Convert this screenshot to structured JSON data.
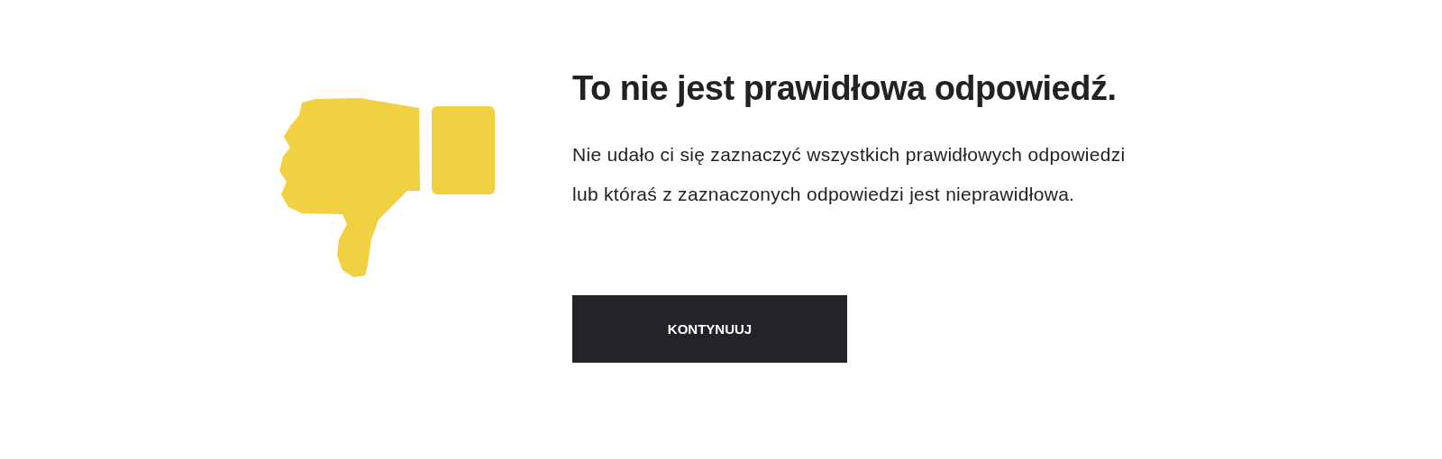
{
  "title": "To nie jest prawidłowa odpowiedź.",
  "message": "Nie udało ci się zaznaczyć wszystkich prawidłowych odpowiedzi lub któraś z zaznaczonych odpowiedzi jest nieprawidłowa.",
  "button": {
    "label": "KONTYNUUJ"
  }
}
